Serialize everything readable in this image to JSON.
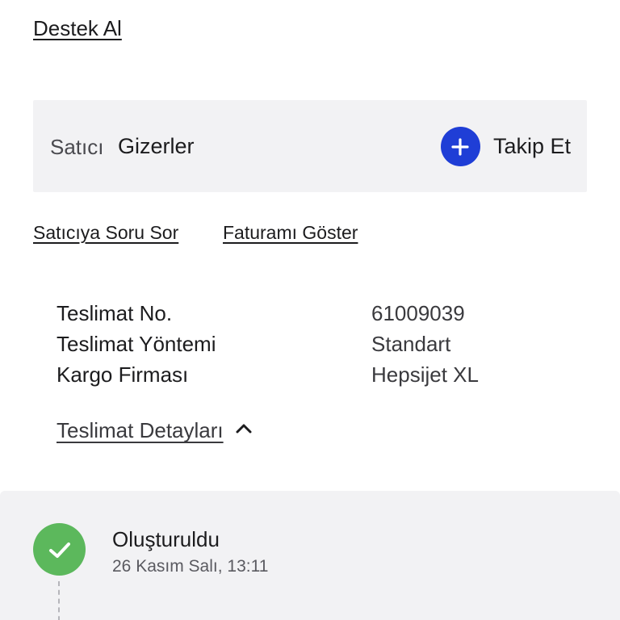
{
  "support": {
    "label": "Destek Al"
  },
  "seller": {
    "label": "Satıcı",
    "name": "Gizerler",
    "follow_label": "Takip Et",
    "follow_icon": "plus-icon",
    "accent": "#1f3ed6"
  },
  "actions": {
    "ask_seller": "Satıcıya Soru Sor",
    "show_invoice": "Faturamı Göster"
  },
  "delivery": {
    "rows": [
      {
        "key": "Teslimat No.",
        "value": "61009039"
      },
      {
        "key": "Teslimat Yöntemi",
        "value": "Standart"
      },
      {
        "key": "Kargo Firması",
        "value": "Hepsijet XL"
      }
    ],
    "details_label": "Teslimat Detayları",
    "details_icon": "chevron-up-icon"
  },
  "timeline": {
    "steps": [
      {
        "title": "Oluşturuldu",
        "date": "26 Kasım Salı, 13:11",
        "icon": "check-icon",
        "color": "#5cb85c"
      }
    ]
  }
}
